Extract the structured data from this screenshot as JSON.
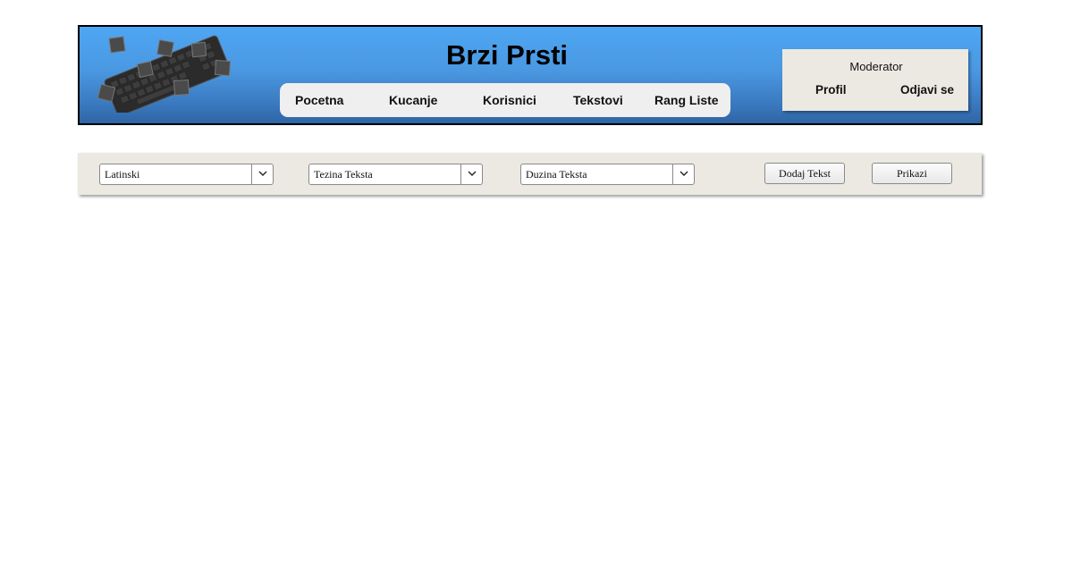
{
  "header": {
    "title": "Brzi Prsti",
    "logo_icon": "keyboard-logo-icon",
    "colors": {
      "gradient_top": "#4ea6f3",
      "gradient_bottom": "#2f65a4",
      "nav_bg": "#efefef",
      "panel_bg": "#ece9e2"
    }
  },
  "nav": {
    "items": [
      {
        "label": "Pocetna"
      },
      {
        "label": "Kucanje"
      },
      {
        "label": "Korisnici"
      },
      {
        "label": "Tekstovi"
      },
      {
        "label": "Rang Liste"
      }
    ]
  },
  "user": {
    "role": "Moderator",
    "profile_label": "Profil",
    "logout_label": "Odjavi se"
  },
  "toolbar": {
    "script_select": {
      "value": "Latinski"
    },
    "difficulty_select": {
      "value": "Tezina Teksta"
    },
    "length_select": {
      "value": "Duzina Teksta"
    },
    "add_text_label": "Dodaj Tekst",
    "show_label": "Prikazi",
    "dropdown_icon": "chevron-down-icon"
  }
}
